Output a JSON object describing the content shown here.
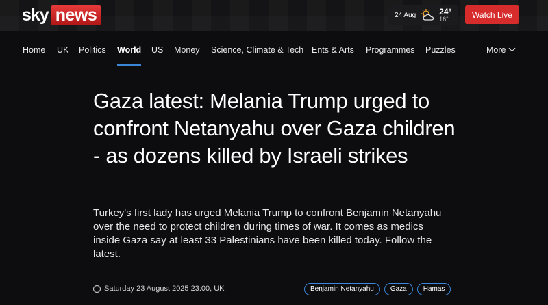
{
  "brand": {
    "sky": "sky",
    "news": "news"
  },
  "weather": {
    "date": "24 Aug",
    "high": "24°",
    "low": "16°",
    "icon": "partly-cloudy-icon"
  },
  "watch_live_label": "Watch Live",
  "nav": {
    "items": [
      "Home",
      "UK",
      "Politics",
      "World",
      "US",
      "Money",
      "Science, Climate & Tech",
      "Ents & Arts",
      "Programmes",
      "Puzzles"
    ],
    "active": "World",
    "more_label": "More"
  },
  "article": {
    "headline": "Gaza latest: Melania Trump urged to confront Netanyahu over Gaza children - as dozens killed by Israeli strikes",
    "standfirst": "Turkey's first lady has urged Melania Trump to confront Benjamin Netanyahu over the need to protect children during times of war. It comes as medics inside Gaza say at least 33 Palestinians have been killed today. Follow the latest.",
    "timestamp": "Saturday 23 August 2025 23:00, UK",
    "tags": [
      "Benjamin Netanyahu",
      "Gaza",
      "Hamas"
    ]
  },
  "colors": {
    "accent": "#3b86d6",
    "brand_red": "#d72c2c",
    "background": "#0d0d0f"
  }
}
